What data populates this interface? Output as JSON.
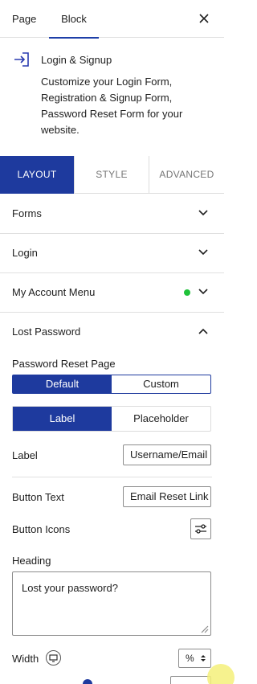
{
  "header": {
    "tabs": [
      {
        "label": "Page"
      },
      {
        "label": "Block"
      }
    ],
    "active_tab": "Block"
  },
  "block": {
    "title": "Login & Signup",
    "description": "Customize your Login Form, Registration & Signup Form, Password Reset Form for your website."
  },
  "settings_tabs": [
    {
      "label": "LAYOUT"
    },
    {
      "label": "STYLE"
    },
    {
      "label": "ADVANCED"
    }
  ],
  "panels": {
    "forms": "Forms",
    "login": "Login",
    "my_account_menu": "My Account Menu",
    "lost_password": "Lost Password"
  },
  "lost_password": {
    "reset_page_label": "Password Reset Page",
    "reset_page_options": [
      "Default",
      "Custom"
    ],
    "reset_page_selected": "Default",
    "mode_options": [
      "Label",
      "Placeholder"
    ],
    "mode_selected": "Label",
    "label_label": "Label",
    "label_value": "Username/Email",
    "button_text_label": "Button Text",
    "button_text_value": "Email Reset Link",
    "button_icons_label": "Button Icons",
    "heading_label": "Heading",
    "heading_value": "Lost your password?",
    "width_label": "Width",
    "width_unit": "%"
  },
  "colors": {
    "accent": "#1e3a9e",
    "status_dot": "#1fc23a"
  }
}
